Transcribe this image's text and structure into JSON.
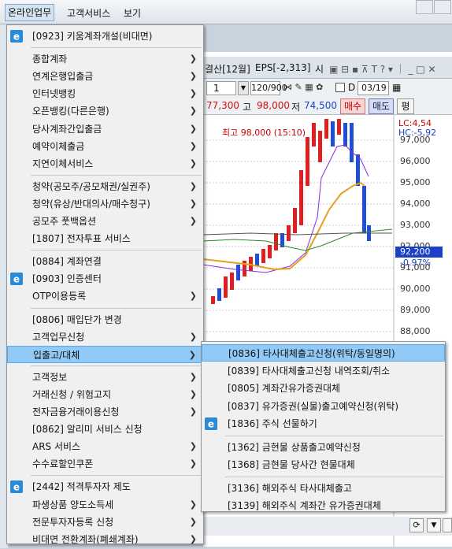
{
  "menubar": {
    "items": [
      "온라인업무",
      "고객서비스",
      "보기"
    ]
  },
  "bgwin": {
    "title_left": "결산[12월]",
    "title_eps": "EPS[-2,313]",
    "title_right": "시",
    "tool_num": "1",
    "tool_count": "120/900",
    "tool_d": "D",
    "tool_date": "03/19",
    "price_last": "77,300",
    "price_high_lbl": "고",
    "price_high": "98,000",
    "price_low_lbl": "저",
    "price_low": "74,500",
    "buy": "매수",
    "sell": "매도",
    "avg": "평"
  },
  "chart_data": {
    "type": "line",
    "annotation": "최고 98,000 (15:10)",
    "right_labels": [
      "LC:4,54",
      "HC:-5,92"
    ],
    "current_price": "92,200",
    "current_change": "-0.97%",
    "ticks": [
      "97,000",
      "96,000",
      "95,000",
      "94,000",
      "93,000",
      "92,000",
      "91,000",
      "90,000",
      "89,000",
      "88,000"
    ]
  },
  "menu": {
    "items": [
      {
        "label": "[0923] 키움계좌개설(비대면)",
        "icon": true,
        "arrow": false
      },
      {
        "sep": true
      },
      {
        "label": "종합계좌",
        "arrow": true
      },
      {
        "label": "연계은행입출금",
        "arrow": true
      },
      {
        "label": "인터넷뱅킹",
        "arrow": true
      },
      {
        "label": "오픈뱅킹(다른은행)",
        "arrow": true
      },
      {
        "label": "당사계좌간입출금",
        "arrow": true
      },
      {
        "label": "예약이체출금",
        "arrow": true
      },
      {
        "label": "지연이체서비스",
        "arrow": true
      },
      {
        "sep": true
      },
      {
        "label": "청약(공모주/공모채권/실권주)",
        "arrow": true
      },
      {
        "label": "청약(유상/반대의사/매수청구)",
        "arrow": true
      },
      {
        "label": "공모주 풋백옵션",
        "arrow": true
      },
      {
        "label": "[1807] 전자투표 서비스",
        "arrow": false
      },
      {
        "sep": true
      },
      {
        "label": "[0884] 계좌연결",
        "arrow": false
      },
      {
        "label": "[0903] 인증센터",
        "icon": true,
        "arrow": false
      },
      {
        "label": "OTP이용등록",
        "arrow": true
      },
      {
        "sep": true
      },
      {
        "label": "[0806] 매입단가 변경",
        "arrow": false
      },
      {
        "label": "고객업무신청",
        "arrow": true
      },
      {
        "label": "입출고/대체",
        "arrow": true,
        "hl": true
      },
      {
        "sep": true
      },
      {
        "label": "고객정보",
        "arrow": true
      },
      {
        "label": "거래신청 / 위험고지",
        "arrow": true
      },
      {
        "label": "전자금융거래이용신청",
        "arrow": true
      },
      {
        "label": "[0862] 알리미 서비스 신청",
        "arrow": false
      },
      {
        "label": "ARS 서비스",
        "arrow": true
      },
      {
        "label": "수수료할인쿠폰",
        "arrow": true
      },
      {
        "sep": true
      },
      {
        "label": "[2442] 적격투자자 제도",
        "icon": true,
        "arrow": false
      },
      {
        "label": "파생상품 양도소득세",
        "arrow": true
      },
      {
        "label": "전문투자자등록 신청",
        "arrow": true
      },
      {
        "label": "비대면 전환계좌(폐쇄계좌)",
        "arrow": true
      }
    ]
  },
  "submenu": {
    "items": [
      {
        "label": "[0836] 타사대체출고신청(위탁/동일명의)",
        "hl": true
      },
      {
        "label": "[0839] 타사대체출고신청 내역조회/취소"
      },
      {
        "label": "[0805] 계좌간유가증권대체"
      },
      {
        "label": "[0837] 유가증권(실물)출고예약신청(위탁)"
      },
      {
        "label": "[1836] 주식 선물하기",
        "icon": true
      },
      {
        "sep": true
      },
      {
        "label": "[1362] 금현물 상품출고예약신청"
      },
      {
        "label": "[1368] 금현물 당사간 현물대체"
      },
      {
        "sep": true
      },
      {
        "label": "[3136] 해외주식 타사대체출고"
      },
      {
        "label": "[3139] 해외주식 계좌간 유가증권대체"
      }
    ]
  },
  "colors": {
    "highlight": "#91c9f7",
    "up": "#e02020",
    "down": "#1f4fd6"
  }
}
